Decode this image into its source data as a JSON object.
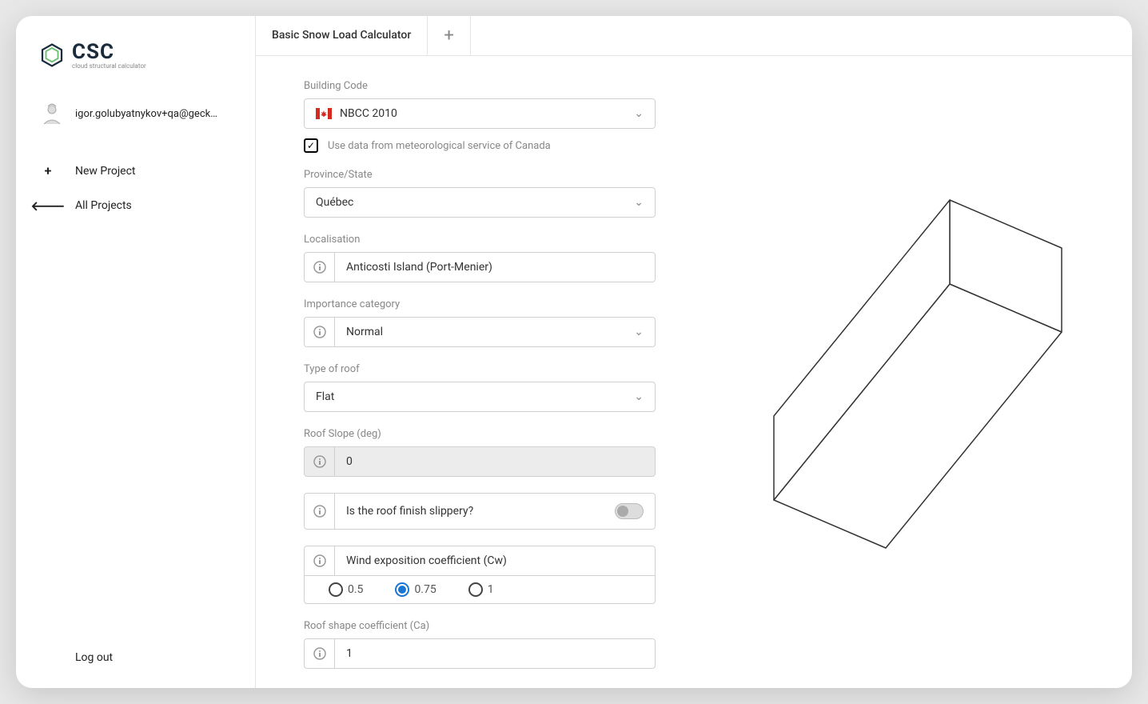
{
  "logo": {
    "text": "CSC",
    "subtitle": "cloud structural calculator"
  },
  "user": {
    "email": "igor.golubyatnykov+qa@geck…"
  },
  "nav": {
    "new_project": "New Project",
    "all_projects": "All Projects"
  },
  "logout_label": "Log out",
  "tabs": {
    "active": "Basic Snow Load Calculator"
  },
  "form": {
    "building_code": {
      "label": "Building Code",
      "value": "NBCC 2010"
    },
    "meteo_checkbox": {
      "label": "Use data from meteorological service of Canada",
      "checked": true
    },
    "province": {
      "label": "Province/State",
      "value": "Québec"
    },
    "localisation": {
      "label": "Localisation",
      "value": "Anticosti Island (Port-Menier)"
    },
    "importance": {
      "label": "Importance category",
      "value": "Normal"
    },
    "roof_type": {
      "label": "Type of roof",
      "value": "Flat"
    },
    "roof_slope": {
      "label": "Roof Slope (deg)",
      "value": "0"
    },
    "slippery": {
      "label": "Is the roof finish slippery?",
      "value": false
    },
    "wind_coeff": {
      "label": "Wind exposition coefficient (Cw)",
      "options": [
        "0.5",
        "0.75",
        "1"
      ],
      "selected": "0.75"
    },
    "roof_shape_coeff": {
      "label": "Roof shape coefficient (Ca)",
      "value": "1"
    }
  }
}
